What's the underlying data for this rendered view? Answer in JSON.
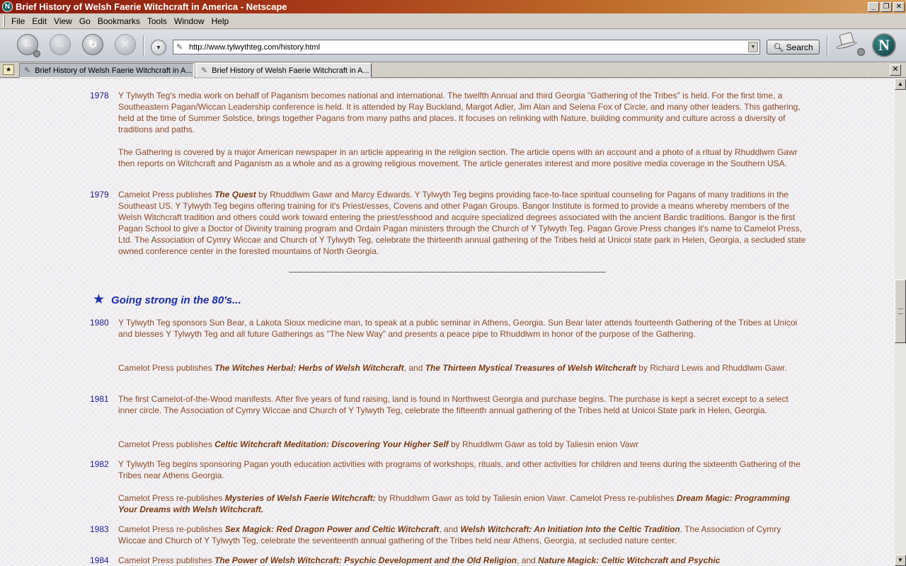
{
  "window": {
    "title": "Brief History of Welsh Faerie Witchcraft in America - Netscape",
    "app_icon": "N",
    "minimize": "_",
    "restore": "❐",
    "close": "✕"
  },
  "menu": [
    "File",
    "Edit",
    "View",
    "Go",
    "Bookmarks",
    "Tools",
    "Window",
    "Help"
  ],
  "toolbar": {
    "url": "http://www.tylwythteg.com/history.html",
    "search_label": "Search",
    "logo": "N"
  },
  "tabs": [
    {
      "label": "Brief History of Welsh Faerie Witchcraft in A..."
    },
    {
      "label": "Brief History of Welsh Faerie Witchcraft in A..."
    }
  ],
  "page": {
    "section_title": "Going strong in the 80's...",
    "entries": [
      {
        "year": "1978",
        "paragraphs": [
          "Y Tylwyth Teg's media work on behalf of Paganism becomes national and international. The twelfth Annual and third Georgia \"Gathering of the Tribes\" is held. For the first time, a Southeastern Pagan/Wiccan Leadership conference is held. It is attended by Ray Buckland, Margot Adler, Jim Alan and Selena Fox of Circle, and many other leaders. This gathering, held at the time of Summer Solstice, brings together Pagans from many paths and places. It focuses on relinking with Nature, building community and culture across a diversity of traditions and paths.",
          "The Gathering is covered by a major American newspaper in an article appearing in the religion section. The article opens with an account and a photo of a ritual by Rhuddlwm Gawr then reports on Witchcraft and Paganism as a whole and as a growing religious movement. The article generates interest and more positive media coverage in the Southern USA."
        ]
      },
      {
        "year": "1979",
        "paragraphs": [
          "Camelot Press publishes |The Quest| by Rhuddlwm Gawr and Marcy Edwards. Y Tylwyth Teg begins providing face-to-face spiritual counseling for Pagans of many traditions in the Southeast US. Y Tylwyth Teg begins offering training for it's Priest/esses, Covens and other Pagan Groups. Bangor Institute is formed to provide a means whereby members of the Welsh Witchcraft tradition and others could work toward entering the priest/esshood and acquire specialized degrees associated with the ancient Bardic traditions. Bangor is the first Pagan School to give a Doctor of Divinity training program and Ordain Pagan ministers through the Church of Y Tylwyth Teg. Pagan Grove Press changes it's name to Camelot Press, Ltd.  The Association of Cymry Wiccae and Church of Y Tylwyth Teg, celebrate the thirteenth annual gathering of the Tribes held at Unicoi state park in Helen, Georgia,  a secluded state owned conference center in the forested mountains of North Georgia."
        ]
      },
      {
        "year": "1980",
        "paragraphs": [
          "Y Tylwyth Teg sponsors Sun Bear, a Lakota Sioux medicine man, to speak at a public seminar in Athens, Georgia. Sun Bear later attends fourteenth Gathering of the Tribes at Unicoi and blesses Y Tylwyth Teg and all future Gatherings as \"The New Way\" and presents a peace pipe to Rhuddlwm in honor of the purpose of the Gathering.",
          "Camelot Press publishes |The Witches Herbal: Herbs of Welsh Witchcraft|, and |The Thirteen Mystical Treasures of Welsh Witchcraft| by Richard Lewis and Rhuddlwm Gawr."
        ]
      },
      {
        "year": "1981",
        "paragraphs": [
          "The first Camelot-of-the-Wood manifests. After five years of fund raising, land is found in Northwest Georgia and purchase begins. The purchase is kept a secret except to a select inner circle.  The Association of Cymry Wiccae and Church of Y Tylwyth Teg, celebrate the fifteenth  annual gathering of the Tribes held at Unicoi State park in Helen, Georgia.",
          "Camelot Press publishes |Celtic Witchcraft Meditation: Discovering Your Higher Self| by  Rhuddlwm Gawr as told by Taliesin enion Vawr"
        ]
      },
      {
        "year": "1982",
        "paragraphs": [
          "Y Tylwyth Teg begins sponsoring Pagan youth education activities with programs of workshops, rituals, and other activities for children and teens during the sixteenth Gathering of the Tribes near Athens Georgia.",
          "Camelot Press re-publishes |Mysteries of Welsh Faerie Witchcraft:| by  Rhuddlwm Gawr as told by Taliesin enion Vawr.   Camelot Press re-publishes |Dream Magic: Programming Your Dreams with Welsh Witchcraft.|"
        ]
      },
      {
        "year": "1983",
        "paragraphs": [
          "Camelot Press re-publishes |Sex Magick: Red Dragon Power and Celtic Witchcraft|, and |Welsh Witchcraft: An Initiation Into the Celtic Tradition|.  The Association of Cymry Wiccae and Church of Y Tylwyth Teg, celebrate the seventeenth annual gathering of the Tribes held near Athens, Georgia, at secluded nature center."
        ]
      },
      {
        "year": "1984",
        "paragraphs": [
          "Camelot Press publishes |The Power of Welsh Witchcraft: Psychic Development and the Old Religion|, and |Nature Magick: Celtic Witchcraft and Psychic|"
        ]
      }
    ]
  },
  "colors": {
    "body_text": "#8a4a28",
    "year_text": "#1c1c8c",
    "section_heading": "#1c2ea8"
  },
  "icons": {
    "back": "back-arrow-icon",
    "forward": "forward-arrow-icon",
    "reload": "reload-icon",
    "stop": "stop-icon",
    "page": "page-icon",
    "search": "magnifier-icon",
    "star": "star-icon"
  }
}
